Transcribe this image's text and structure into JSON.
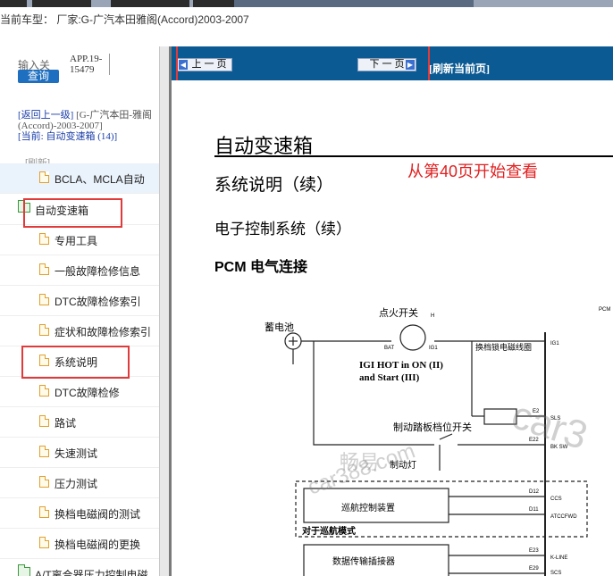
{
  "header": {
    "vehicle": "当前车型： 厂家:G-广汽本田雅阁(Accord)2003-2007"
  },
  "sidebar": {
    "input_label": "输入关",
    "query_button": "查询",
    "app_no": "APP.19-15479",
    "nav": {
      "back_link": "[返回上一级]",
      "back_text": "[G-广汽本田-雅阁(Accord)-2003-2007]",
      "current_prefix": "[当前: ",
      "current_link": "自动变速箱",
      "current_count": " (14)]"
    },
    "refresh": "[刷新]",
    "items": [
      {
        "label": "BCLA、MCLA自动"
      },
      {
        "label": "自动变速箱"
      },
      {
        "label": "专用工具"
      },
      {
        "label": "一般故障检修信息"
      },
      {
        "label": "DTC故障检修索引"
      },
      {
        "label": "症状和故障检修索引"
      },
      {
        "label": "系统说明"
      },
      {
        "label": "DTC故障检修"
      },
      {
        "label": "路试"
      },
      {
        "label": "失速测试"
      },
      {
        "label": "压力测试"
      },
      {
        "label": "换档电磁阀的测试"
      },
      {
        "label": "换档电磁阀的更换"
      },
      {
        "label": "A/T离合器压力控制电磁"
      }
    ]
  },
  "toolbar": {
    "prev_label": "上 一 页",
    "next_label": "下 一 页",
    "refresh_label": "[刷新当前页]"
  },
  "document": {
    "title": "自动变速箱",
    "subtitle": "系统说明（续）",
    "section": "电子控制系统（续）",
    "subsection": "PCM 电气连接",
    "annotation": "从第40页开始查看",
    "diagram": {
      "battery": "蓄电池",
      "ignition": "点火开关",
      "ignition_h": "H",
      "bat": "BAT",
      "ig1": "IG1",
      "igi_note": "IGI HOT in ON (II)",
      "igi_note2": "and Start (III)",
      "shift_lock": "换档锁电磁线圈",
      "brake_switch": "制动踏板档位开关",
      "brake_light": "制动灯",
      "cruise": "巡航控制装置",
      "cruise_mode": "对于巡航模式",
      "dlc": "数据传输插接器",
      "pins": [
        "IG1",
        "SLS",
        "BK SW",
        "CCS",
        "ATCCFWD",
        "K-LINE",
        "SCS"
      ],
      "pin_ids": [
        "E2",
        "E22",
        "D12",
        "D11",
        "E23",
        "E29"
      ],
      "pcm": "PCM"
    },
    "watermarks": [
      "畅易",
      "car388.com",
      "car3"
    ]
  },
  "colors": {
    "toolbar_bg": "#0b5a93",
    "red_box": "#e03a3a",
    "annotation": "#e02020",
    "query_btn": "#1e6fc0"
  }
}
